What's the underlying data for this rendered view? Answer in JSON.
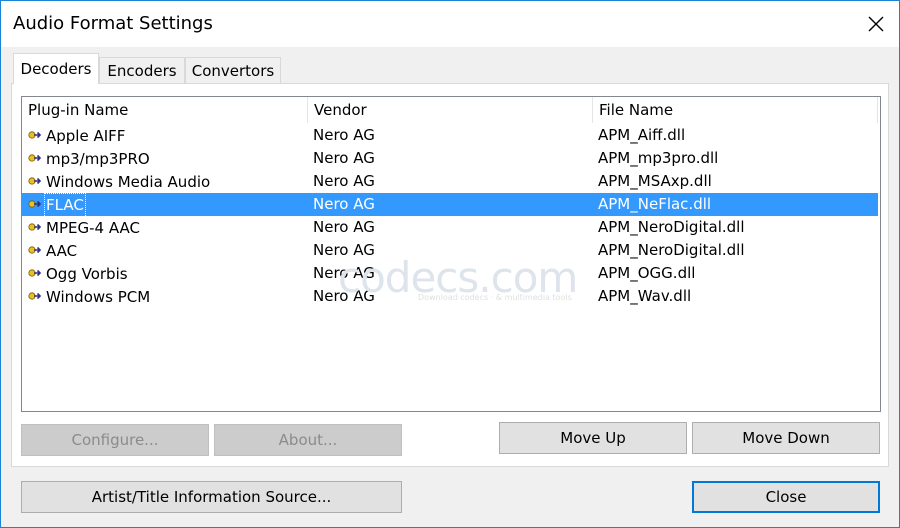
{
  "window": {
    "title": "Audio Format Settings"
  },
  "tabs": [
    {
      "label": "Decoders",
      "active": true
    },
    {
      "label": "Encoders",
      "active": false
    },
    {
      "label": "Convertors",
      "active": false
    }
  ],
  "list": {
    "columns": [
      "Plug-in Name",
      "Vendor",
      "File Name"
    ],
    "rows": [
      {
        "name": "Apple AIFF",
        "vendor": "Nero AG",
        "file": "APM_Aiff.dll"
      },
      {
        "name": "mp3/mp3PRO",
        "vendor": "Nero AG",
        "file": "APM_mp3pro.dll"
      },
      {
        "name": "Windows Media Audio",
        "vendor": "Nero AG",
        "file": "APM_MSAxp.dll"
      },
      {
        "name": "FLAC",
        "vendor": "Nero AG",
        "file": "APM_NeFlac.dll",
        "selected": true
      },
      {
        "name": "MPEG-4 AAC",
        "vendor": "Nero AG",
        "file": "APM_NeroDigital.dll"
      },
      {
        "name": "AAC",
        "vendor": "Nero AG",
        "file": "APM_NeroDigital.dll"
      },
      {
        "name": "Ogg Vorbis",
        "vendor": "Nero AG",
        "file": "APM_OGG.dll"
      },
      {
        "name": "Windows PCM",
        "vendor": "Nero AG",
        "file": "APM_Wav.dll"
      }
    ],
    "row_icon": "plugin-arrow-icon"
  },
  "watermark": {
    "main": "codecs.com",
    "sub": "Download codecs · & multimedia tools"
  },
  "buttons": {
    "configure": "Configure...",
    "about": "About...",
    "move_up": "Move Up",
    "move_down": "Move Down",
    "artist_title": "Artist/Title Information Source...",
    "close": "Close"
  },
  "colors": {
    "selection": "#3399ff",
    "window_border": "#1883d7",
    "default_button_border": "#0078d7"
  }
}
